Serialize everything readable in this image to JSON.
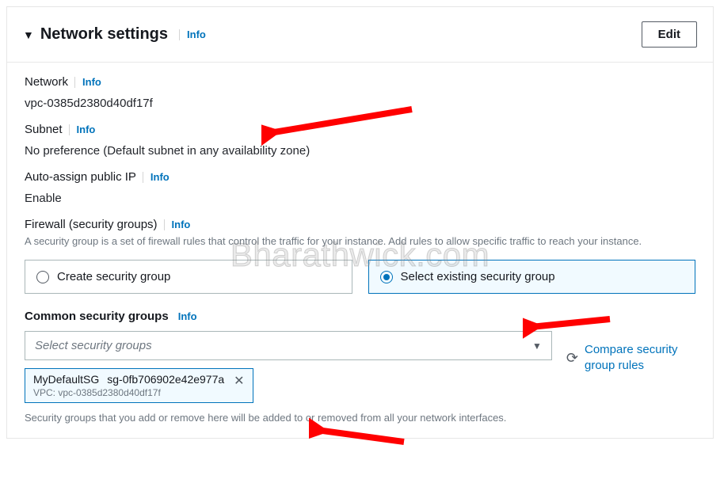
{
  "header": {
    "title": "Network settings",
    "info": "Info",
    "edit": "Edit"
  },
  "network": {
    "label": "Network",
    "info": "Info",
    "value": "vpc-0385d2380d40df17f"
  },
  "subnet": {
    "label": "Subnet",
    "info": "Info",
    "value": "No preference (Default subnet in any availability zone)"
  },
  "autoip": {
    "label": "Auto-assign public IP",
    "info": "Info",
    "value": "Enable"
  },
  "firewall": {
    "label": "Firewall (security groups)",
    "info": "Info",
    "help": "A security group is a set of firewall rules that control the traffic for your instance. Add rules to allow specific traffic to reach your instance.",
    "options": [
      {
        "label": "Create security group",
        "selected": false
      },
      {
        "label": "Select existing security group",
        "selected": true
      }
    ]
  },
  "common_sg": {
    "label": "Common security groups",
    "info": "Info",
    "placeholder": "Select security groups",
    "selected": {
      "name": "MyDefaultSG",
      "id": "sg-0fb706902e42e977a",
      "vpc": "VPC: vpc-0385d2380d40df17f"
    },
    "footer": "Security groups that you add or remove here will be added to or removed from all your network interfaces.",
    "compare": "Compare security group rules"
  },
  "watermark": "Bharathwick.com"
}
